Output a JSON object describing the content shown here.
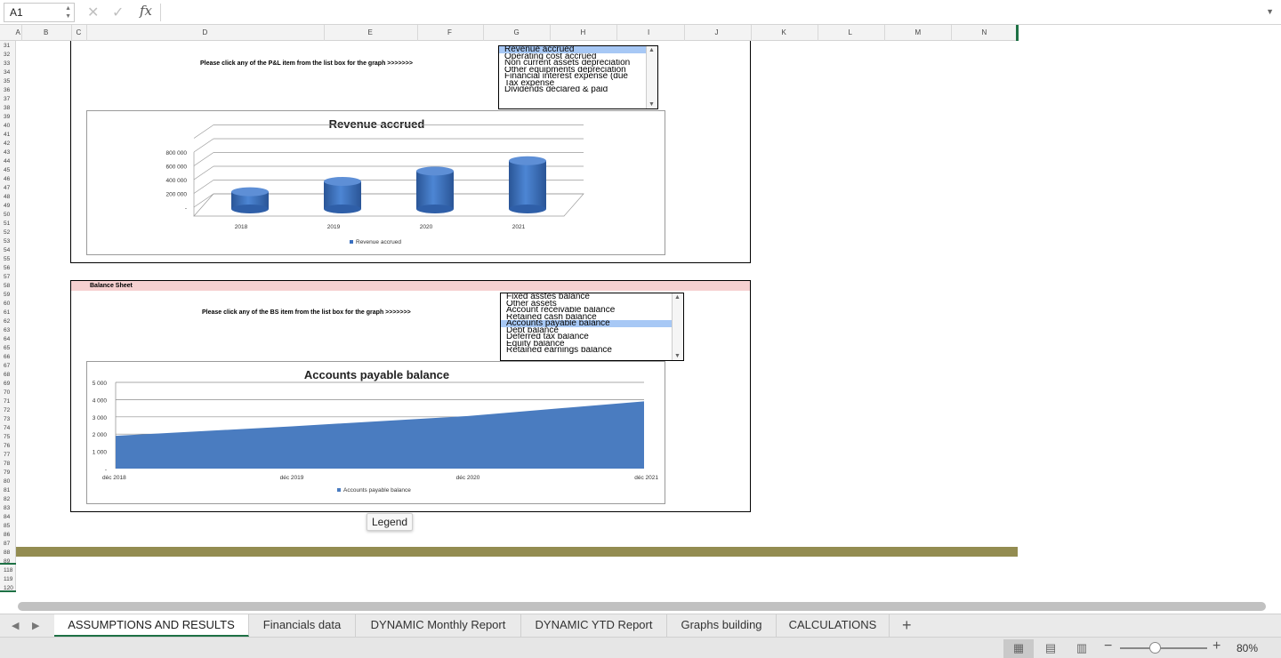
{
  "formula_bar": {
    "name_box": "A1",
    "fx_label": "fx",
    "formula": ""
  },
  "columns": [
    "A",
    "B",
    "C",
    "D",
    "E",
    "F",
    "G",
    "H",
    "I",
    "J",
    "K",
    "L",
    "M",
    "N"
  ],
  "rows": [
    "31",
    "32",
    "33",
    "34",
    "35",
    "36",
    "37",
    "38",
    "39",
    "40",
    "41",
    "42",
    "43",
    "44",
    "45",
    "46",
    "47",
    "48",
    "49",
    "50",
    "51",
    "52",
    "53",
    "54",
    "55",
    "56",
    "57",
    "58",
    "59",
    "60",
    "61",
    "62",
    "63",
    "64",
    "65",
    "66",
    "67",
    "68",
    "69",
    "70",
    "71",
    "72",
    "73",
    "74",
    "75",
    "76",
    "77",
    "78",
    "79",
    "80",
    "81",
    "82",
    "83",
    "84",
    "85",
    "86",
    "87",
    "88",
    "89",
    "118",
    "119",
    "120"
  ],
  "pl_section": {
    "prompt": "Please click any of the P&L item from the list box for the graph >>>>>>>",
    "list_items": [
      "Revenue accrued",
      "Operating cost accrued",
      "Non current assets depreciation",
      "Other equipments depreciation",
      "Financial interest expense (due",
      "Tax expense",
      "Dividends declared & paid"
    ],
    "selected_index": 0
  },
  "bs_section": {
    "header": "Balance Sheet",
    "prompt": "Please click any of the BS item from the list box for the graph >>>>>>>",
    "list_items": [
      "Fixed asstes balance",
      "Other assets",
      "Account receivable balance",
      "Retained cash balance",
      "Accounts payable balance",
      "Debt balance",
      "Deferred tax balance",
      "Equity balance",
      "Retained earnings balance"
    ],
    "selected_index": 4
  },
  "chart_data": [
    {
      "type": "bar",
      "title": "Revenue accrued",
      "categories": [
        "2018",
        "2019",
        "2020",
        "2021"
      ],
      "series": [
        {
          "name": "Revenue accrued",
          "values": [
            250000,
            400000,
            550000,
            700000
          ]
        }
      ],
      "y_ticks": [
        "800 000",
        "600 000",
        "400 000",
        "200 000",
        "-"
      ],
      "ylim": [
        0,
        800000
      ],
      "legend_position": "bottom",
      "color": "#3a6fc0"
    },
    {
      "type": "area",
      "title": "Accounts payable balance",
      "categories": [
        "déc 2018",
        "déc 2019",
        "déc 2020",
        "déc 2021"
      ],
      "series": [
        {
          "name": "Accounts payable balance",
          "values": [
            1900,
            2450,
            3050,
            3900
          ]
        }
      ],
      "y_ticks": [
        "5 000",
        "4 000",
        "3 000",
        "2 000",
        "1 000",
        "-"
      ],
      "ylim": [
        0,
        5000
      ],
      "legend_position": "bottom",
      "color": "#4a7cc0"
    }
  ],
  "tooltip": "Legend",
  "sheet_tabs": [
    "ASSUMPTIONS AND RESULTS",
    "Financials data",
    "DYNAMIC Monthly Report",
    "DYNAMIC YTD Report",
    "Graphs building",
    "CALCULATIONS"
  ],
  "active_tab": 0,
  "status": {
    "zoom": "80%"
  }
}
